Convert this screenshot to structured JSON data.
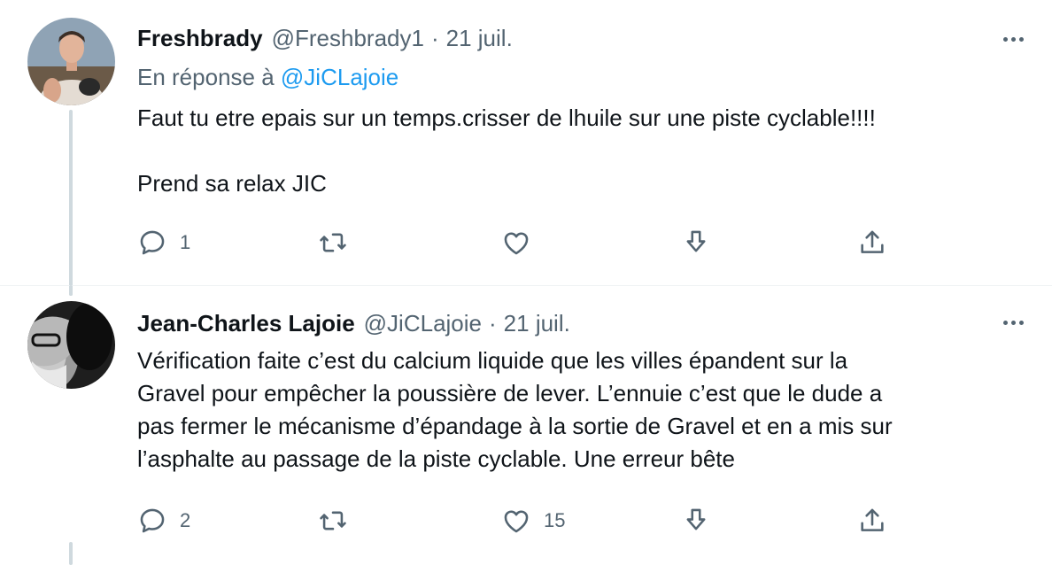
{
  "tweets": [
    {
      "display_name": "Freshbrady",
      "handle": "@Freshbrady1",
      "separator": "·",
      "timestamp": "21 juil.",
      "reply_to_prefix": "En réponse à",
      "reply_to_handle": "@JiCLajoie",
      "text_lines": [
        "Faut tu etre epais sur un temps.crisser de lhuile sur une piste cyclable!!!!",
        "Prend sa relax JIC"
      ],
      "reply_count": "1",
      "retweet_count": "",
      "like_count": "",
      "avatar_icon": "avatar-photo-icon"
    },
    {
      "display_name": "Jean-Charles Lajoie",
      "handle": "@JiCLajoie",
      "separator": "·",
      "timestamp": "21 juil.",
      "text_lines": [
        "Vérification faite c’est du calcium liquide que les villes épandent sur la",
        "Gravel pour empêcher la poussière de lever. L’ennuie c’est que le dude a",
        "pas fermer le mécanisme d’épandage à la sortie de Gravel et en a mis sur",
        "l’asphalte au passage de la piste cyclable. Une erreur bête"
      ],
      "reply_count": "2",
      "retweet_count": "",
      "like_count": "15",
      "avatar_icon": "avatar-photo-icon"
    }
  ],
  "colors": {
    "text": "#0f1419",
    "secondary": "#536471",
    "link": "#1d9bf0",
    "thread_line": "#cfd9de",
    "divider": "#eff3f4"
  },
  "icons": [
    "reply-icon",
    "retweet-icon",
    "like-icon",
    "download-icon",
    "share-icon",
    "more-icon"
  ]
}
